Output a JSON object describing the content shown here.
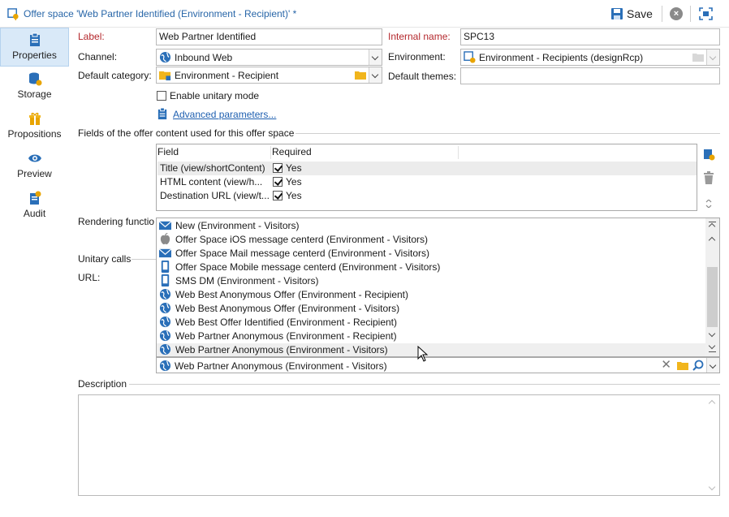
{
  "window": {
    "title": "Offer space 'Web Partner Identified (Environment - Recipient)' *",
    "save_label": "Save"
  },
  "sidebar": {
    "items": [
      {
        "label": "Properties",
        "icon": "clipboard-icon",
        "active": true
      },
      {
        "label": "Storage",
        "icon": "database-icon",
        "active": false
      },
      {
        "label": "Propositions",
        "icon": "gift-icon",
        "active": false
      },
      {
        "label": "Preview",
        "icon": "eye-icon",
        "active": false
      },
      {
        "label": "Audit",
        "icon": "audit-icon",
        "active": false
      }
    ]
  },
  "form": {
    "label_label": "Label:",
    "label_value": "Web Partner Identified",
    "internal_name_label": "Internal name:",
    "internal_name_value": "SPC13",
    "channel_label": "Channel:",
    "channel_value": "Inbound Web",
    "environment_label": "Environment:",
    "environment_value": "Environment - Recipients (designRcp)",
    "default_category_label": "Default category:",
    "default_category_value": "Environment - Recipient",
    "default_themes_label": "Default themes:",
    "default_themes_value": "",
    "unitary_mode_label": "Enable unitary mode",
    "advanced_link": "Advanced parameters...",
    "fields_section": "Fields of the offer content used for this offer space",
    "rendering_label": "Rendering functio",
    "unitary_calls_label": "Unitary calls",
    "url_label": "URL:",
    "description_label": "Description"
  },
  "fields_grid": {
    "headers": [
      "Field",
      "Required"
    ],
    "rows": [
      {
        "field": "Title (view/shortContent)",
        "required": "Yes"
      },
      {
        "field": "HTML content (view/h...",
        "required": "Yes"
      },
      {
        "field": "Destination URL (view/t...",
        "required": "Yes"
      }
    ]
  },
  "dropdown_list": {
    "items": [
      {
        "label": "New (Environment - Visitors)",
        "icon": "mail-icon"
      },
      {
        "label": "Offer Space iOS message centerd (Environment - Visitors)",
        "icon": "apple-icon"
      },
      {
        "label": "Offer Space Mail message centerd (Environment - Visitors)",
        "icon": "mail-icon"
      },
      {
        "label": "Offer Space Mobile message centerd (Environment - Visitors)",
        "icon": "mobile-icon"
      },
      {
        "label": "SMS DM (Environment - Visitors)",
        "icon": "mobile-icon"
      },
      {
        "label": "Web Best Anonymous Offer (Environment - Recipient)",
        "icon": "globe-icon"
      },
      {
        "label": "Web Best Anonymous Offer (Environment - Visitors)",
        "icon": "globe-icon"
      },
      {
        "label": "Web Best Offer Identified (Environment - Recipient)",
        "icon": "globe-icon"
      },
      {
        "label": "Web Partner Anonymous (Environment - Recipient)",
        "icon": "globe-icon"
      },
      {
        "label": "Web Partner Anonymous (Environment - Visitors)",
        "icon": "globe-icon"
      }
    ],
    "selected_value": "Web Partner Anonymous (Environment - Visitors)"
  },
  "colors": {
    "title_blue": "#2866a8",
    "required_red": "#b4282d",
    "active_tab": "#d9e9f8"
  }
}
